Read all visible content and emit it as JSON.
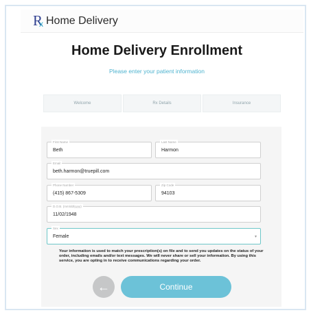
{
  "header": {
    "logo_text": "Rx",
    "brand": "Home Delivery"
  },
  "page": {
    "title": "Home Delivery Enrollment",
    "subtitle": "Please enter your patient information"
  },
  "steps": [
    "Welcome",
    "Rx Details",
    "Insurance"
  ],
  "form": {
    "first_name": {
      "label": "First Name",
      "value": "Beth"
    },
    "last_name": {
      "label": "Last Name",
      "value": "Harmon"
    },
    "email": {
      "label": "Email",
      "value": "beth.harmon@truepill.com"
    },
    "phone": {
      "label": "Phone Number",
      "value": "(415) 867-5309"
    },
    "zip": {
      "label": "Zip Code",
      "value": "94103"
    },
    "dob": {
      "label": "D.O.B. (mm/dd/yyyy)",
      "value": "11/02/1948"
    },
    "sex": {
      "label": "Sex",
      "value": "Female"
    }
  },
  "disclaimer": "Your information is used to match your prescription(s) on file and to send you updates on the status of your order, including emails and/or text messages. We will never share or sell your information. By using this service, you are opting in to receive communications regarding your order.",
  "buttons": {
    "back_icon": "←",
    "continue": "Continue"
  },
  "colors": {
    "accent": "#6cc2d8",
    "brand": "#2f3f8f",
    "subtitle": "#4fb3cf"
  }
}
